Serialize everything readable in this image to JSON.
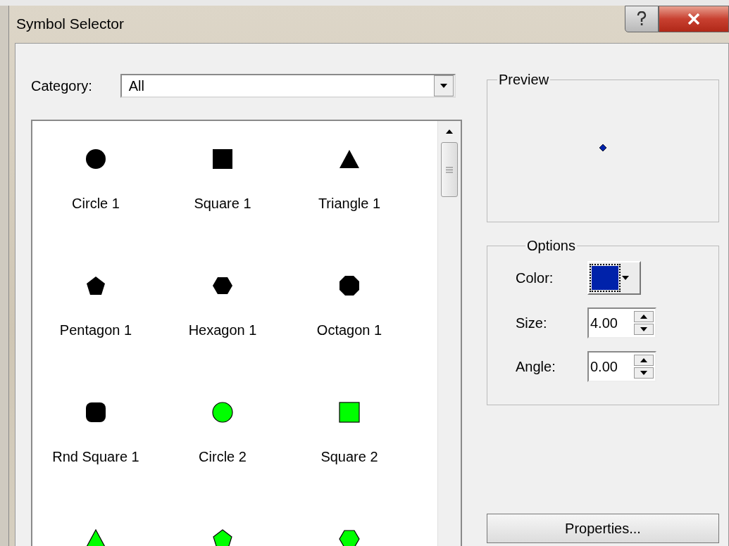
{
  "window": {
    "title": "Symbol Selector"
  },
  "category": {
    "label": "Category:",
    "value": "All"
  },
  "symbols": [
    {
      "label": "Circle 1",
      "kind": "circle",
      "color": "#000000"
    },
    {
      "label": "Square 1",
      "kind": "square",
      "color": "#000000"
    },
    {
      "label": "Triangle 1",
      "kind": "triangle",
      "color": "#000000"
    },
    {
      "label": "Pentagon 1",
      "kind": "pentagon",
      "color": "#000000"
    },
    {
      "label": "Hexagon 1",
      "kind": "hexagon",
      "color": "#000000"
    },
    {
      "label": "Octagon 1",
      "kind": "octagon",
      "color": "#000000"
    },
    {
      "label": "Rnd Square 1",
      "kind": "roundsquare",
      "color": "#000000"
    },
    {
      "label": "Circle 2",
      "kind": "circle",
      "color": "#00ff00"
    },
    {
      "label": "Square 2",
      "kind": "square",
      "color": "#00ff00"
    },
    {
      "kind": "triangle",
      "color": "#00ff00"
    },
    {
      "kind": "pentagon",
      "color": "#00ff00"
    },
    {
      "kind": "hexagon",
      "color": "#00ff00"
    }
  ],
  "preview": {
    "title": "Preview"
  },
  "options": {
    "title": "Options",
    "color_label": "Color:",
    "color": "#0022aa",
    "size_label": "Size:",
    "size": "4.00",
    "angle_label": "Angle:",
    "angle": "0.00"
  },
  "buttons": [
    "Properties..."
  ]
}
